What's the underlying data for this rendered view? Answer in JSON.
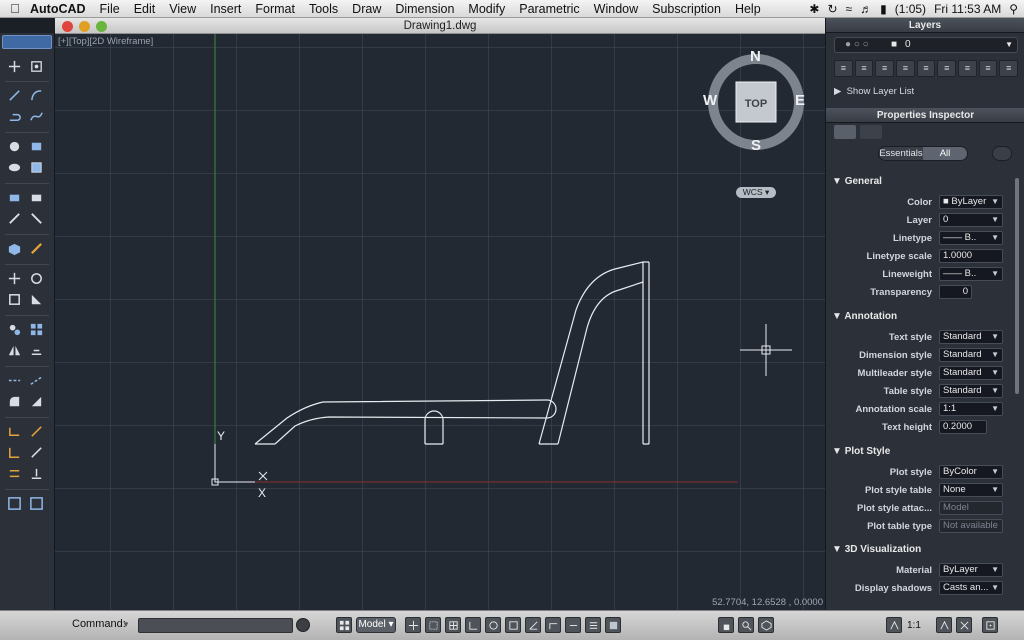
{
  "menubar": {
    "app_name": "AutoCAD",
    "items": [
      "File",
      "Edit",
      "View",
      "Insert",
      "Format",
      "Tools",
      "Draw",
      "Dimension",
      "Modify",
      "Parametric",
      "Window",
      "Subscription",
      "Help"
    ],
    "battery": "(1:05)",
    "clock": "Fri 11:53 AM"
  },
  "window": {
    "title": "Drawing1.dwg",
    "viewport_label": "[+][Top][2D Wireframe]",
    "coordinates": "52.7704, 12.6528 , 0.0000",
    "viewcube": {
      "top_label": "TOP",
      "north": "N",
      "south": "S",
      "east": "E",
      "west": "W",
      "wcs_label": "WCS"
    },
    "ucs": {
      "y_label": "Y",
      "x_label": "X"
    }
  },
  "status_bar": {
    "command_label": "Command:",
    "command_value": "",
    "model_label": "Model",
    "scale_label": "1:1"
  },
  "layers_panel": {
    "header": "Layers",
    "current_layer": "0",
    "show_layer_list": "Show Layer List"
  },
  "properties_panel": {
    "header": "Properties Inspector",
    "seg_essentials": "Essentials",
    "seg_all": "All",
    "sections": {
      "general": "General",
      "annotation": "Annotation",
      "plot_style": "Plot Style",
      "visualization": "3D Visualization"
    },
    "general": [
      {
        "label": "Color",
        "value": "ByLayer"
      },
      {
        "label": "Layer",
        "value": "0"
      },
      {
        "label": "Linetype",
        "value": "B.."
      },
      {
        "label": "Linetype scale",
        "value": "1.0000"
      },
      {
        "label": "Lineweight",
        "value": "B.."
      },
      {
        "label": "Transparency",
        "value": "0"
      }
    ],
    "annotation": [
      {
        "label": "Text style",
        "value": "Standard"
      },
      {
        "label": "Dimension style",
        "value": "Standard"
      },
      {
        "label": "Multileader style",
        "value": "Standard"
      },
      {
        "label": "Table style",
        "value": "Standard"
      },
      {
        "label": "Annotation scale",
        "value": "1:1"
      },
      {
        "label": "Text height",
        "value": "0.2000"
      }
    ],
    "plot_style": [
      {
        "label": "Plot style",
        "value": "ByColor"
      },
      {
        "label": "Plot style table",
        "value": "None"
      },
      {
        "label": "Plot style attac...",
        "value": "Model"
      },
      {
        "label": "Plot table type",
        "value": "Not available"
      }
    ],
    "visualization": [
      {
        "label": "Material",
        "value": "ByLayer"
      },
      {
        "label": "Display shadows",
        "value": "Casts an..."
      }
    ]
  },
  "colors": {
    "canvas_bg": "#232933",
    "drawing_lines": "#e8ecf0",
    "y_axis": "#3c8a3c",
    "x_axis": "#8a2e2e",
    "accent": "#3f6aa4"
  }
}
